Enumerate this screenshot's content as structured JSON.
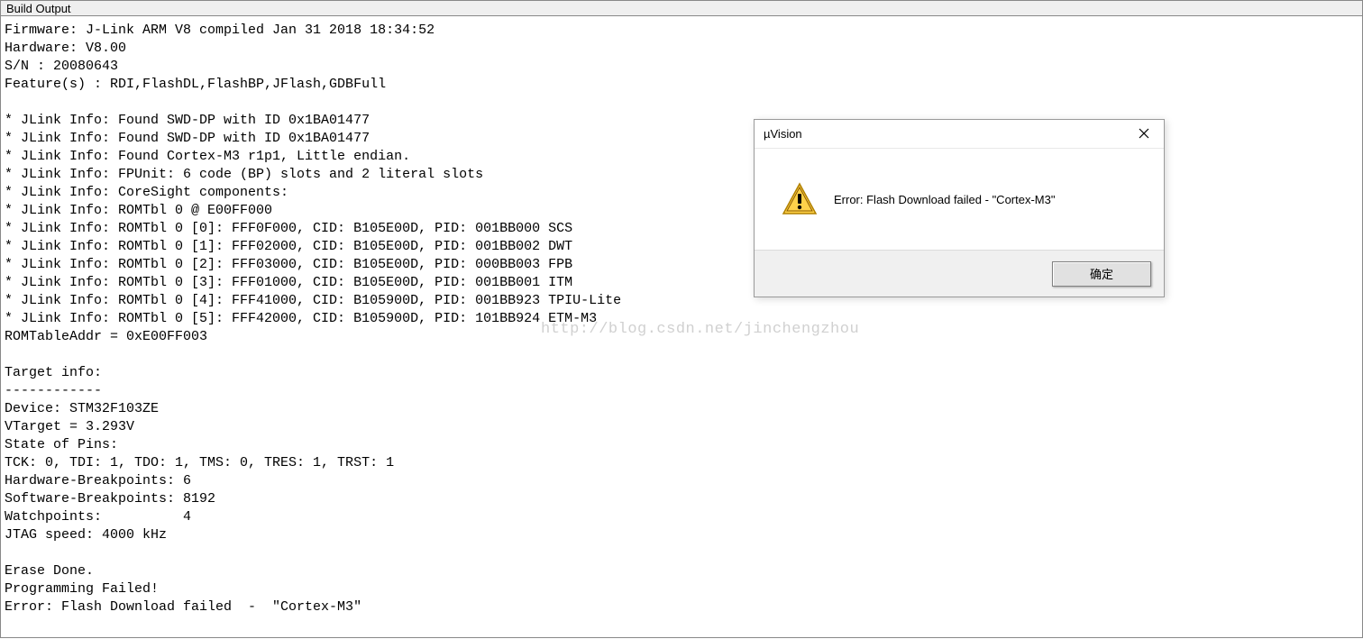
{
  "panel": {
    "title": "Build Output"
  },
  "output": {
    "lines": [
      "Firmware: J-Link ARM V8 compiled Jan 31 2018 18:34:52",
      "Hardware: V8.00",
      "S/N : 20080643",
      "Feature(s) : RDI,FlashDL,FlashBP,JFlash,GDBFull",
      " ",
      "* JLink Info: Found SWD-DP with ID 0x1BA01477",
      "* JLink Info: Found SWD-DP with ID 0x1BA01477",
      "* JLink Info: Found Cortex-M3 r1p1, Little endian.",
      "* JLink Info: FPUnit: 6 code (BP) slots and 2 literal slots",
      "* JLink Info: CoreSight components:",
      "* JLink Info: ROMTbl 0 @ E00FF000",
      "* JLink Info: ROMTbl 0 [0]: FFF0F000, CID: B105E00D, PID: 001BB000 SCS",
      "* JLink Info: ROMTbl 0 [1]: FFF02000, CID: B105E00D, PID: 001BB002 DWT",
      "* JLink Info: ROMTbl 0 [2]: FFF03000, CID: B105E00D, PID: 000BB003 FPB",
      "* JLink Info: ROMTbl 0 [3]: FFF01000, CID: B105E00D, PID: 001BB001 ITM",
      "* JLink Info: ROMTbl 0 [4]: FFF41000, CID: B105900D, PID: 001BB923 TPIU-Lite",
      "* JLink Info: ROMTbl 0 [5]: FFF42000, CID: B105900D, PID: 101BB924 ETM-M3",
      "ROMTableAddr = 0xE00FF003",
      " ",
      "Target info:",
      "------------",
      "Device: STM32F103ZE",
      "VTarget = 3.293V",
      "State of Pins: ",
      "TCK: 0, TDI: 1, TDO: 1, TMS: 0, TRES: 1, TRST: 1",
      "Hardware-Breakpoints: 6",
      "Software-Breakpoints: 8192",
      "Watchpoints:          4",
      "JTAG speed: 4000 kHz",
      " ",
      "Erase Done.",
      "Programming Failed!",
      "Error: Flash Download failed  -  \"Cortex-M3\""
    ]
  },
  "dialog": {
    "title": "µVision",
    "message": "Error: Flash Download failed  -  \"Cortex-M3\"",
    "ok_label": "确定"
  },
  "watermark": {
    "text": "http://blog.csdn.net/jinchengzhou"
  }
}
